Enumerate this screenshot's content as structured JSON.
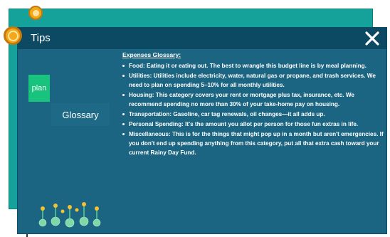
{
  "window": {
    "title": "Tips"
  },
  "tabs": [
    {
      "label": "plan"
    },
    {
      "label": "Glossary"
    }
  ],
  "glossary": {
    "heading": "Expenses Glossary:",
    "items": [
      "Food: Eating it or eating out. The best to wrangle this budget line is by meal planning.",
      "Utilities: Utilities include electricity, water, natural gas or propane, and trash services. We need to plan on spending 5–10% for all monthly utilities.",
      "Housing: This category covers your rent or mortgage plus tax, insurance, etc. We recommend spending no more than 30% of your take-home pay on housing.",
      "Transportation: Gasoline, car tag renewals, oil changes—it all adds up.",
      "Personal Spending: It's the amount you allot per person for those fun extras in life.",
      "Miscellaneous: This is for the things that might pop up in a month but aren't emergencies. If you don't end up spending anything from this category, put all that extra cash toward your current Rainy Day Fund."
    ]
  },
  "icons": {
    "coin": "coin-icon",
    "close": "close-icon",
    "plants": "money-plants-icon"
  },
  "colors": {
    "window_bg": "#1b6582",
    "titlebar": "#0c4a63",
    "back_panel": "#15a29b",
    "plan_tab": "#18c47d",
    "coin": "#f2a81d"
  }
}
